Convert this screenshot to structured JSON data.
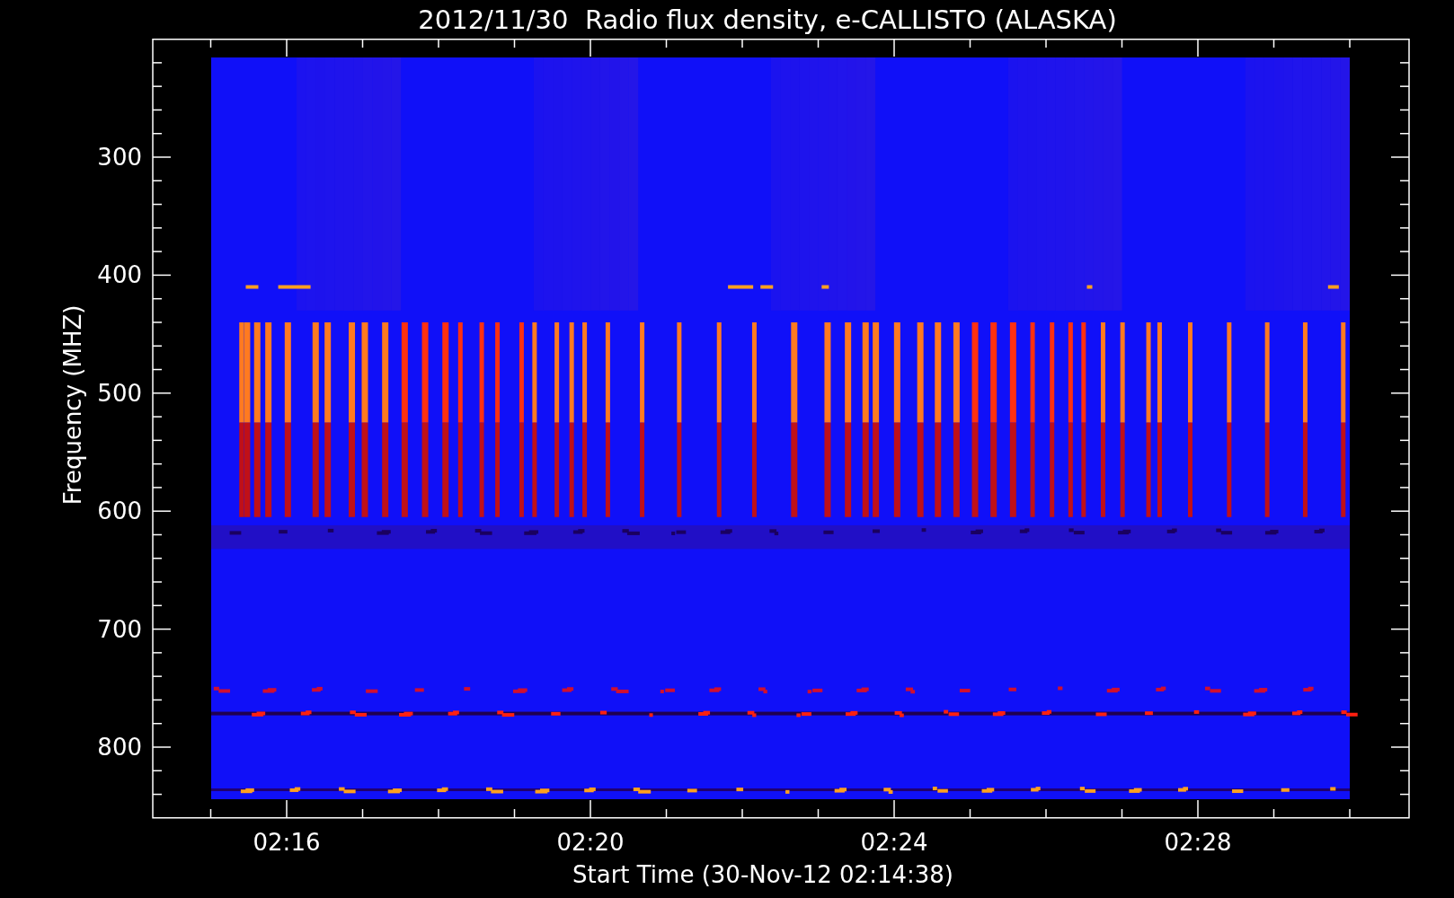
{
  "title": "2012/11/30  Radio flux density, e-CALLISTO (ALASKA)",
  "y_axis": {
    "label": "Frequency (MHZ)",
    "ticks": [
      "300",
      "400",
      "500",
      "600",
      "700",
      "800"
    ]
  },
  "x_axis": {
    "label": "Start Time (30-Nov-12 02:14:38)",
    "ticks": [
      "02:16",
      "02:20",
      "02:24",
      "02:28"
    ]
  }
}
